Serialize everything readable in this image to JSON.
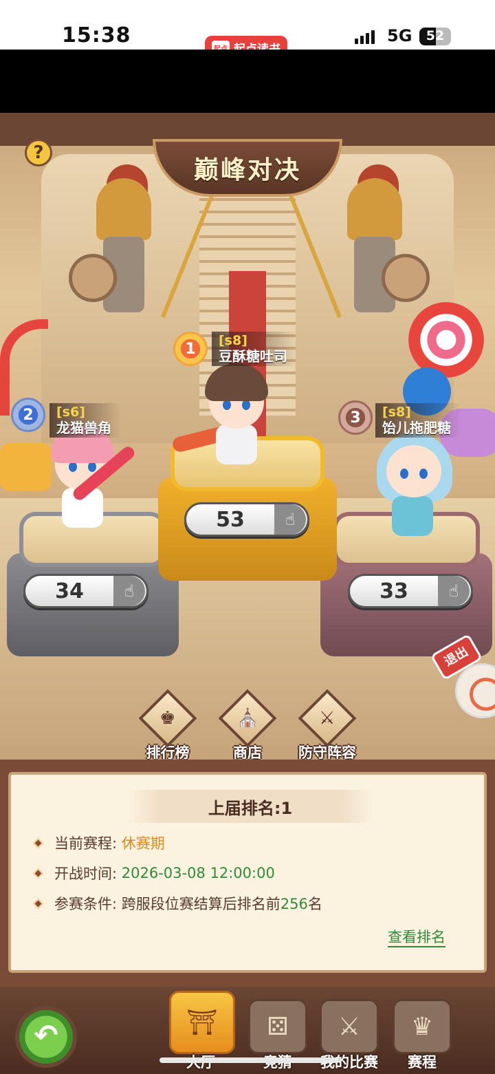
{
  "status_bar": {
    "time": "15:38",
    "network": "5G",
    "battery": "52",
    "battery_level": 0.52,
    "app_pill_label": "起点读书",
    "app_pill_logo": "起点"
  },
  "header": {
    "title": "巅峰对决",
    "help_label": "?"
  },
  "podiums": [
    {
      "rank": "1",
      "server": "[s8]",
      "name": "豆酥糖吐司",
      "likes": "53"
    },
    {
      "rank": "2",
      "server": "[s6]",
      "name": "龙猫兽角",
      "likes": "34"
    },
    {
      "rank": "3",
      "server": "[s8]",
      "name": "饴儿拖肥糖",
      "likes": "33"
    }
  ],
  "side_buttons": {
    "exit_label": "退出"
  },
  "menu": [
    {
      "label": "排行榜",
      "icon": "podium-icon"
    },
    {
      "label": "商店",
      "icon": "shop-icon"
    },
    {
      "label": "防守阵容",
      "icon": "crossed-swords-shield-icon"
    }
  ],
  "info": {
    "title": "上届排名:1",
    "rows": [
      {
        "key": "当前赛程:",
        "value": "休赛期"
      },
      {
        "key": "开战时间:",
        "value": "2026-03-08 12:00:00"
      },
      {
        "key": "参赛条件:",
        "value_prefix": "跨服段位赛结算后排名前",
        "value_num": "256",
        "value_suffix": "名"
      }
    ],
    "view_ranking": "查看排名"
  },
  "bottom_nav": [
    {
      "label": "大厅",
      "icon": "hall-icon",
      "active": true
    },
    {
      "label": "竞猜",
      "icon": "dice-icon",
      "active": false
    },
    {
      "label": "我的比赛",
      "icon": "scroll-sword-icon",
      "active": false
    },
    {
      "label": "赛程",
      "icon": "trophy-icon",
      "active": false
    }
  ],
  "colors": {
    "accent_gold": "#f2b92a",
    "link_green": "#2e8b3a",
    "stage_orange": "#d98a1f",
    "exit_red": "#d8403a"
  }
}
